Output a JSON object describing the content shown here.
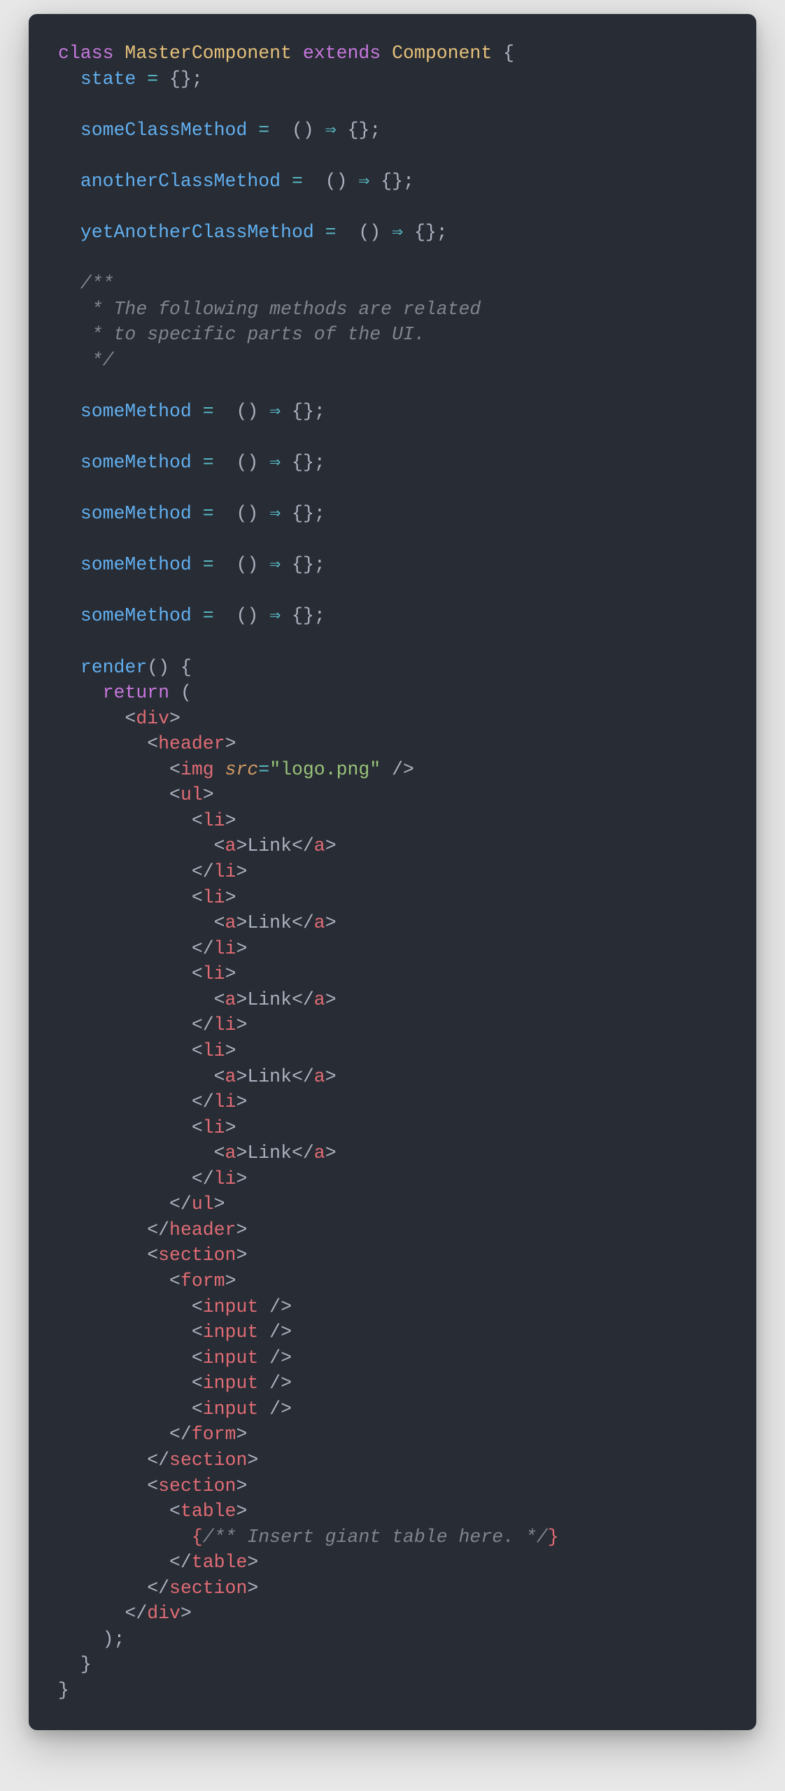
{
  "code": {
    "kw_class": "class",
    "name_master": "MasterComponent",
    "kw_extends": "extends",
    "name_component": "Component",
    "brace_open": " {",
    "state_name": "state",
    "eq": " = ",
    "empty_obj": "{};",
    "m1": "someClassMethod",
    "m2": "anotherClassMethod",
    "m3": "yetAnotherClassMethod",
    "arrow_paren": " () ",
    "arrow": "⇒",
    "arrow_body": " {};",
    "cmt1": "/**",
    "cmt2": " * The following methods are related",
    "cmt3": " * to specific parts of the UI.",
    "cmt4": " */",
    "sm": "someMethod",
    "render": "render",
    "render_sig": "() {",
    "kw_return": "return",
    "ret_open": " (",
    "lt": "<",
    "gt": ">",
    "ltc": "</",
    "sc": "/>",
    "tag_div": "div",
    "tag_header": "header",
    "tag_img": "img",
    "attr_src": "src",
    "attr_eq": "=",
    "src_val": "\"logo.png\"",
    "tag_ul": "ul",
    "tag_li": "li",
    "tag_a": "a",
    "link_txt": "Link",
    "tag_section": "section",
    "tag_form": "form",
    "tag_input": "input",
    "tag_table": "table",
    "jsx_cmt": "/** Insert giant table here. */",
    "brace_l": "{",
    "brace_r": "}",
    "ret_close": ");",
    "close_brace": "}"
  }
}
